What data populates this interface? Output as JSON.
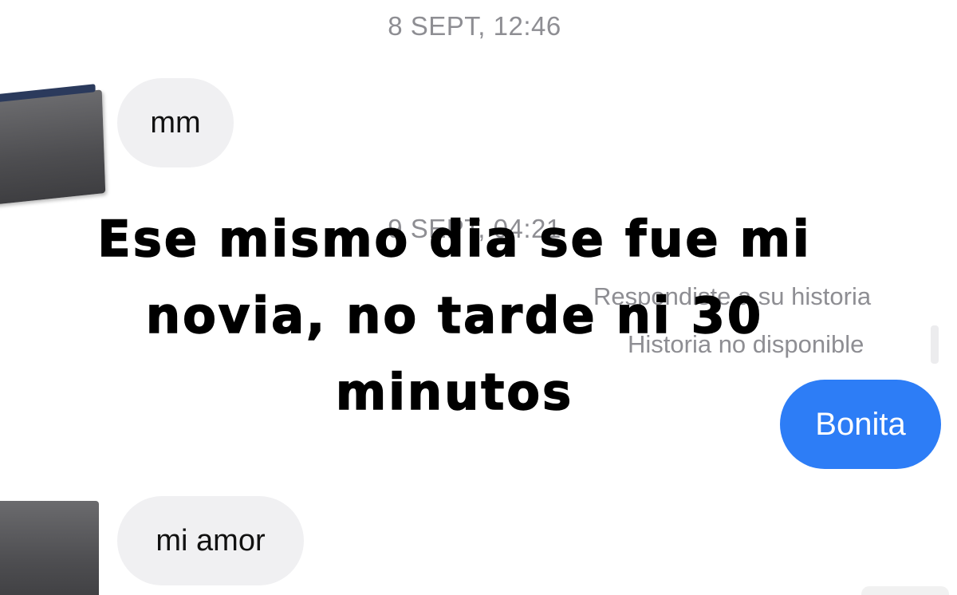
{
  "conversation": {
    "timestamps": [
      "8 SEPT, 12:46",
      "9 SEPT, 04:21"
    ],
    "messages": {
      "incoming_1": "mm",
      "outgoing_reply_label": "Respondiste a su historia",
      "story_unavailable": "Historia no disponible",
      "outgoing_1": "Bonita",
      "incoming_2": "mi amor"
    },
    "colors": {
      "incoming_bubble": "#f0f0f2",
      "outgoing_bubble": "#2d7df6",
      "timestamp_text": "#8e8e93"
    }
  },
  "caption": {
    "text": "Ese mismo dia se fue mi novia, no tarde ni 30 minutos"
  }
}
